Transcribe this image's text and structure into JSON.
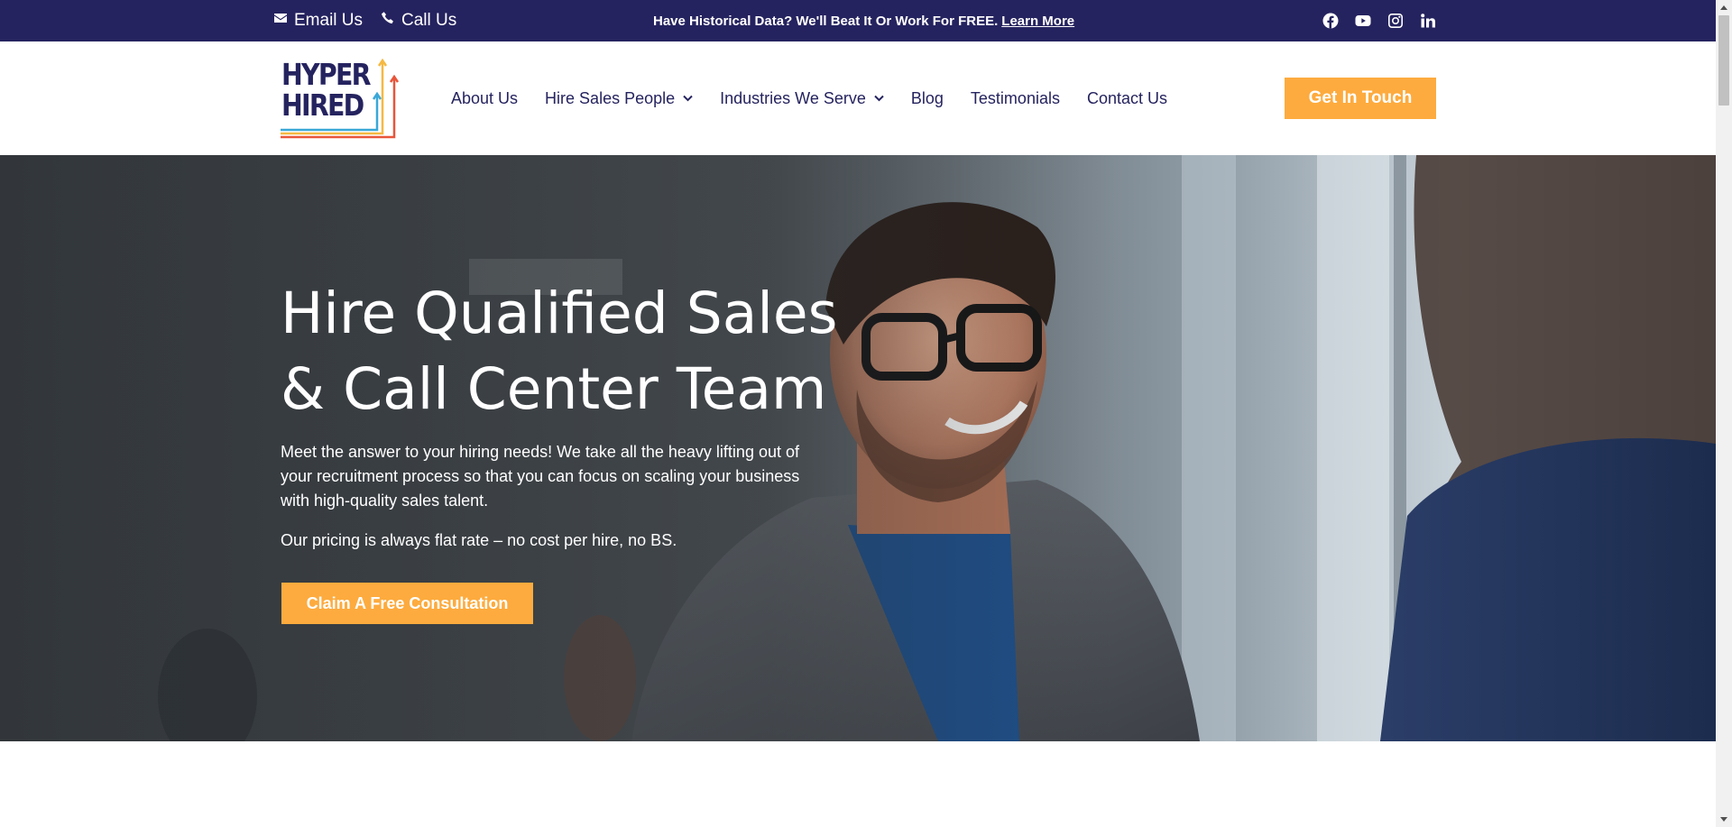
{
  "topbar": {
    "email_label": "Email Us",
    "call_label": "Call Us",
    "promo_text": "Have Historical Data? We'll Beat It Or Work For FREE.",
    "promo_link": "Learn More",
    "social_icons": [
      "facebook-icon",
      "youtube-icon",
      "instagram-icon",
      "linkedin-icon"
    ]
  },
  "logo": {
    "line1": "HYPER",
    "line2": "HIRED"
  },
  "nav": {
    "items": [
      {
        "label": "About Us",
        "has_dropdown": false
      },
      {
        "label": "Hire Sales People",
        "has_dropdown": true
      },
      {
        "label": "Industries We Serve",
        "has_dropdown": true
      },
      {
        "label": "Blog",
        "has_dropdown": false
      },
      {
        "label": "Testimonials",
        "has_dropdown": false
      },
      {
        "label": "Contact Us",
        "has_dropdown": false
      }
    ],
    "cta_label": "Get In Touch"
  },
  "hero": {
    "title_line1": "Hire Qualified Sales",
    "title_line2": "& Call Center Team",
    "paragraph1": "Meet the answer to your hiring needs! We take all the heavy lifting out of your recruitment process so that you can focus on scaling your business with high-quality sales talent.",
    "paragraph2": "Our pricing is always flat rate – no cost per hire, no BS.",
    "cta_label": "Claim A Free Consultation"
  },
  "colors": {
    "navy": "#25235f",
    "accent_orange": "#fdab3e",
    "logo_blue": "#3aa8d8",
    "logo_red": "#e8553a",
    "logo_yellow": "#f5b942"
  }
}
